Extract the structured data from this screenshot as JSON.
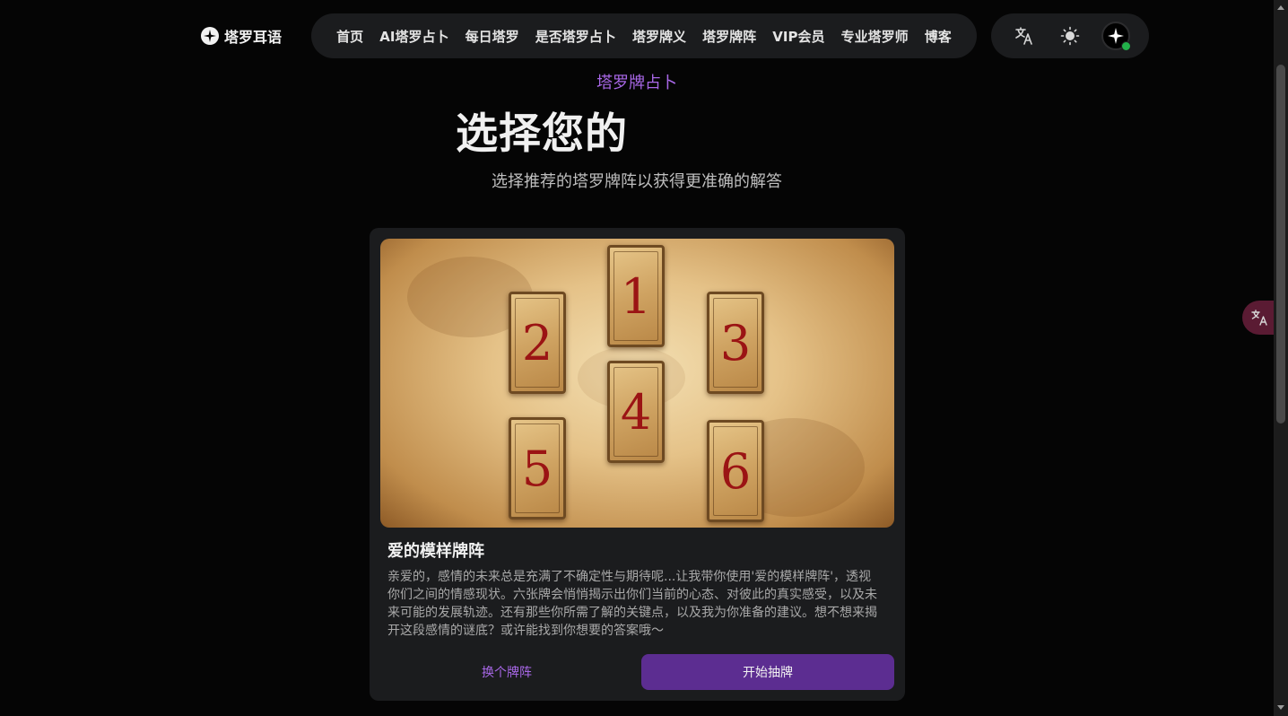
{
  "header": {
    "brand": {
      "name": "塔罗耳语",
      "logo_icon": "sparkle-plus-icon"
    },
    "nav": [
      {
        "label": "首页"
      },
      {
        "label": "AI塔罗占卜"
      },
      {
        "label": "每日塔罗"
      },
      {
        "label": "是否塔罗占卜"
      },
      {
        "label": "塔罗牌义"
      },
      {
        "label": "塔罗牌阵"
      },
      {
        "label": "VIP会员"
      },
      {
        "label": "专业塔罗师"
      },
      {
        "label": "博客"
      }
    ],
    "tools": {
      "translate_icon": "translate-icon",
      "theme_icon": "sun-icon",
      "avatar_icon": "sparkle-icon",
      "status_color": "#22b04a"
    }
  },
  "hero": {
    "eyebrow": "塔罗牌占卜",
    "headline": "选择您的",
    "subline": "选择推荐的塔罗牌阵以获得更准确的解答"
  },
  "spread_card": {
    "image_cards": [
      "1",
      "2",
      "3",
      "4",
      "5",
      "6"
    ],
    "title": "爱的模样牌阵",
    "description": "亲爱的，感情的未来总是充满了不确定性与期待呢...让我带你使用'爱的模样牌阵'，透视你们之间的情感现状。六张牌会悄悄揭示出你们当前的心态、对彼此的真实感受，以及未来可能的发展轨迹。还有那些你所需了解的关键点，以及我为你准备的建议。想不想来揭开这段感情的谜底？或许能找到你想要的答案哦～",
    "secondary_button": "换个牌阵",
    "primary_button": "开始抽牌"
  },
  "floating": {
    "translate_icon": "translate-icon"
  },
  "colors": {
    "accent": "#a968e8",
    "primary_button": "#5c2d91",
    "background": "#050505",
    "card": "#1b1c1e"
  }
}
